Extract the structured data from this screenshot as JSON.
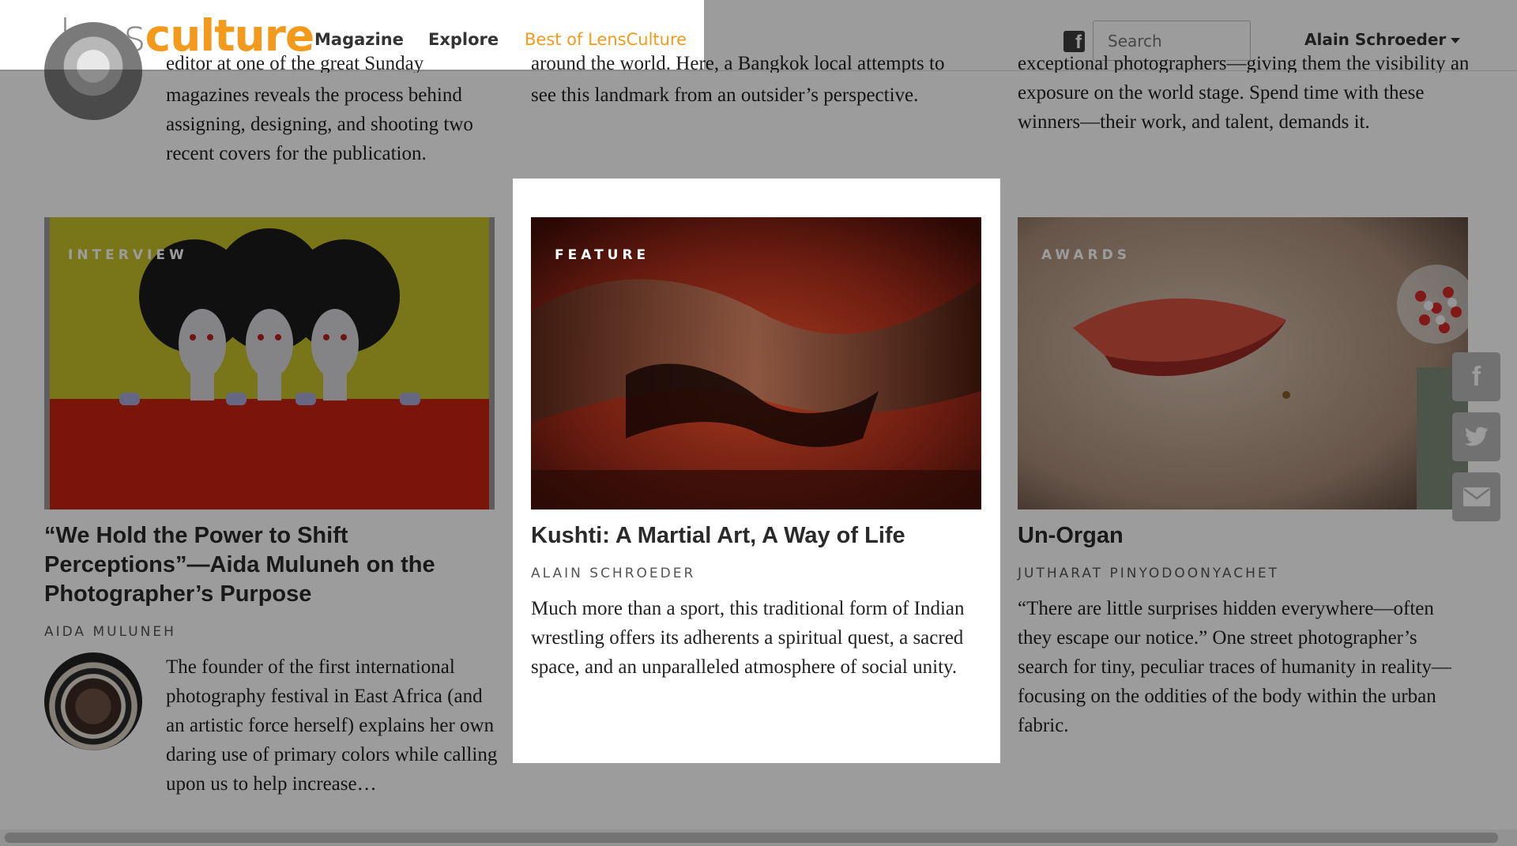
{
  "header": {
    "logo_lens": "lens",
    "logo_culture": "culture",
    "nav": [
      "Magazine",
      "Explore",
      "Best of LensCulture"
    ],
    "search_placeholder": "Search",
    "user_name": "Alain Schroeder"
  },
  "top_row": {
    "left_cut": "editor at one of the great Sunday",
    "left_desc": "magazines reveals the process behind assigning, designing, and shooting two recent covers for the publication.",
    "mid_cut": "around the world. Here, a Bangkok local attempts to",
    "mid_desc": "see this landmark from an outsider’s perspective.",
    "right_cut": "exceptional photographers—giving them the visibility and",
    "right_desc": "exposure on the world stage. Spend time with these winners—their work, and talent, demands it."
  },
  "cards": [
    {
      "tag": "INTERVIEW",
      "title": "“We Hold the Power to Shift Perceptions”—Aida Muluneh on the Photographer’s Purpose",
      "author": "AIDA MULUNEH",
      "desc": "The founder of the first international photography festival in East Africa (and an artistic force herself) explains her own daring use of primary colors while calling upon us to help increase…"
    },
    {
      "tag": "FEATURE",
      "title": "Kushti: A Martial Art, A Way of Life",
      "author": "ALAIN SCHROEDER",
      "desc": "Much more than a sport, this traditional form of Indian wrestling offers its adherents a spiritual quest, a sacred space, and an unparalleled atmosphere of social unity."
    },
    {
      "tag": "AWARDS",
      "title": "Un-Organ",
      "author": "JUTHARAT PINYODOONYACHET",
      "desc": "“There are little surprises hidden everywhere—often they escape our notice.” One street photographer’s search for tiny, peculiar traces of humanity in reality—focusing on the oddities of the body within the urban fabric."
    }
  ],
  "social": {
    "facebook": "f",
    "twitter": "twitter-icon",
    "email": "email-icon"
  },
  "colors": {
    "brand_orange": "#f39a1d",
    "logo_gray": "#8a8a8a",
    "overlay": "rgba(0,0,0,0.39)"
  }
}
